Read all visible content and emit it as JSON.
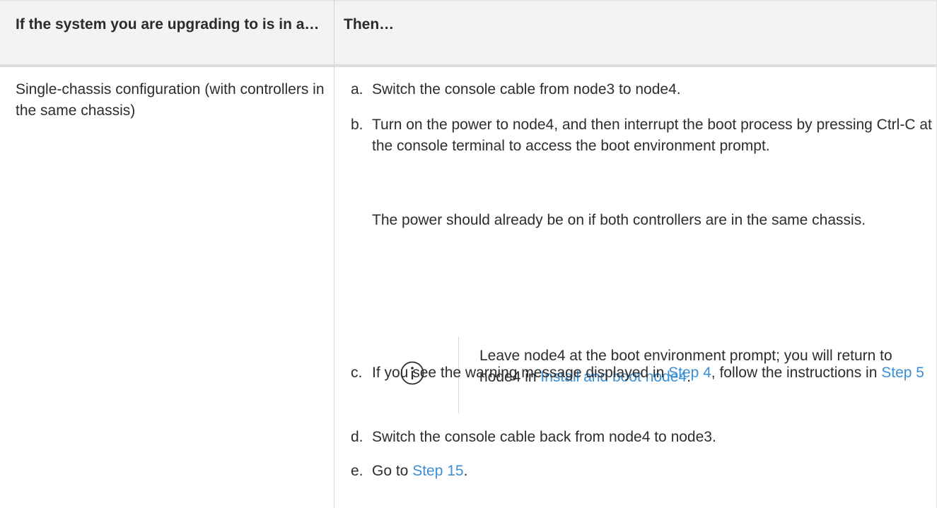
{
  "table": {
    "header_col1": "If the system you are upgrading to is in a…",
    "header_col2": "Then…",
    "row_col1": "Single-chassis configuration (with controllers in the same chassis)",
    "steps": [
      {
        "marker": "a.",
        "text": "Switch the console cable from node3 to node4."
      },
      {
        "marker": "b.",
        "text": "Turn on the power to node4, and then interrupt the boot process by pressing Ctrl-C at the console terminal to access the boot environment prompt.",
        "para": "The power should already be on if both controllers are in the same chassis."
      },
      {
        "marker": "c.",
        "text_before": "If you see the warning message displayed in ",
        "link1": "Step 4",
        "text_mid": ", follow the instructions in ",
        "link2": "Step 5"
      },
      {
        "marker": "d.",
        "text": "Switch the console cable back from node4 to node3."
      },
      {
        "marker": "e.",
        "text_before": "Go to ",
        "link": "Step 15",
        "text_after": "."
      }
    ],
    "note": {
      "icon": "info-icon",
      "text_before": "Leave node4 at the boot environment prompt; you will return to node4 in ",
      "link": "Install and boot node4",
      "text_after": "."
    }
  },
  "colors": {
    "link": "#3b8fd6",
    "header_bg": "#f3f3f3",
    "text": "#2d2d2d"
  }
}
